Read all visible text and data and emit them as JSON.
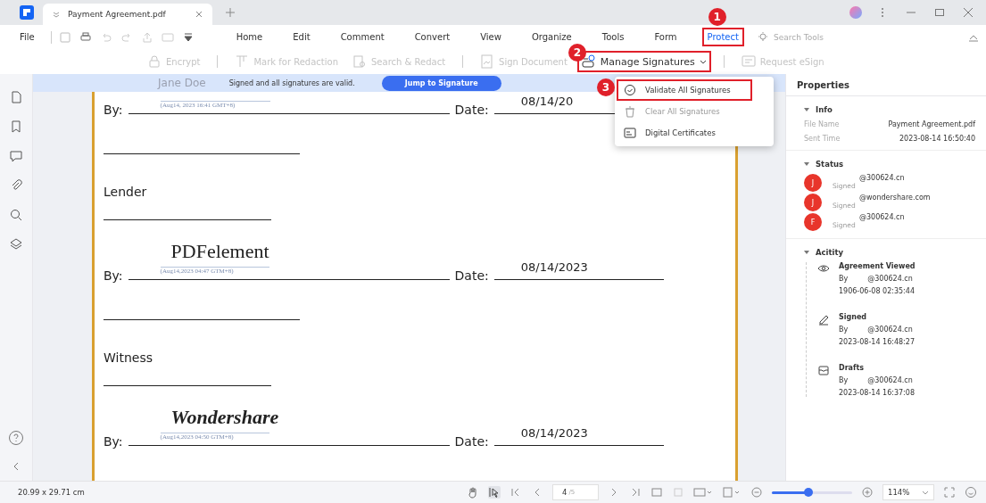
{
  "app": {
    "tab_title": "Payment Agreement.pdf"
  },
  "menu": {
    "file": "File",
    "tabs": [
      {
        "label": "Home",
        "selected": false
      },
      {
        "label": "Edit",
        "selected": false
      },
      {
        "label": "Comment",
        "selected": false
      },
      {
        "label": "Convert",
        "selected": false
      },
      {
        "label": "View",
        "selected": false
      },
      {
        "label": "Organize",
        "selected": false
      },
      {
        "label": "Tools",
        "selected": false
      },
      {
        "label": "Form",
        "selected": false
      },
      {
        "label": "Protect",
        "selected": true,
        "callout": "1"
      }
    ],
    "search": {
      "placeholder": "Search Tools"
    }
  },
  "ribbon": [
    {
      "kind": "lock",
      "label": "Encrypt",
      "disabled": true
    },
    {
      "kind": "redact",
      "label": "Mark for Redaction",
      "disabled": true
    },
    {
      "kind": "search",
      "label": "Search & Redact",
      "disabled": true
    },
    {
      "kind": "sign",
      "label": "Sign Document",
      "disabled": true
    },
    {
      "kind": "manage",
      "label": "Manage Signatures",
      "disabled": false,
      "callout": "2"
    },
    {
      "kind": "esign",
      "label": "Request eSign",
      "disabled": true
    }
  ],
  "dropdown": [
    {
      "kind": "validate",
      "label": "Validate All Signatures",
      "disabled": false,
      "callout": "3"
    },
    {
      "kind": "clear",
      "label": "Clear All Signatures",
      "disabled": true
    },
    {
      "kind": "cert",
      "label": "Digital Certificates",
      "disabled": false
    }
  ],
  "banner": {
    "signer": "Jane Doe",
    "message": "Signed and all signatures are valid.",
    "button": "Jump to Signature"
  },
  "document": [
    {
      "kind": "signature",
      "by": "By:",
      "stamp": "(Aug14, 2023 16:41 GMT+8)",
      "date_label": "Date:",
      "date": "08/14/20"
    },
    {
      "kind": "line"
    },
    {
      "kind": "heading",
      "text": "Lender"
    },
    {
      "kind": "line"
    },
    {
      "kind": "signature",
      "signature": "PDFelement",
      "by": "By:",
      "stamp": "(Aug14,2023 04:47 GTM+8)",
      "date_label": "Date:",
      "date": "08/14/2023"
    },
    {
      "kind": "line"
    },
    {
      "kind": "heading",
      "text": "Witness"
    },
    {
      "kind": "line"
    },
    {
      "kind": "signature",
      "signature": "Wondershare",
      "by": "By:",
      "stamp": "(Aug14,2023 04:50 GTM+8)",
      "date_label": "Date:",
      "date": "08/14/2023"
    }
  ],
  "properties": {
    "title": "Properties",
    "info": {
      "heading": "Info",
      "fields": [
        {
          "label": "File Name",
          "value": "Payment Agreement.pdf"
        },
        {
          "label": "Sent Time",
          "value": "2023-08-14 16:50:40"
        }
      ]
    },
    "status": {
      "heading": "Status",
      "signers": [
        {
          "initial": "J",
          "email": "@300624.cn",
          "state": "Signed",
          "color": "#e8352b"
        },
        {
          "initial": "J",
          "email": "@wondershare.com",
          "state": "Signed",
          "color": "#e8352b"
        },
        {
          "initial": "F",
          "email": "@300624.cn",
          "state": "Signed",
          "color": "#e8352b"
        }
      ]
    },
    "activity": {
      "heading": "Acitity",
      "items": [
        {
          "kind": "view",
          "title": "Agreement Viewed",
          "by": "By",
          "who": "@300624.cn",
          "time": "1906-06-08 02:35:44"
        },
        {
          "kind": "sign",
          "title": "Signed",
          "by": "By",
          "who": "@300624.cn",
          "time": "2023-08-14 16:48:27"
        },
        {
          "kind": "draft",
          "title": "Drafts",
          "by": "By",
          "who": "@300624.cn",
          "time": "2023-08-14 16:37:08"
        }
      ]
    }
  },
  "status_bar": {
    "size": "20.99 x 29.71 cm",
    "page": "4",
    "pages": "/5",
    "level": 0.45,
    "zoom": "114%"
  }
}
